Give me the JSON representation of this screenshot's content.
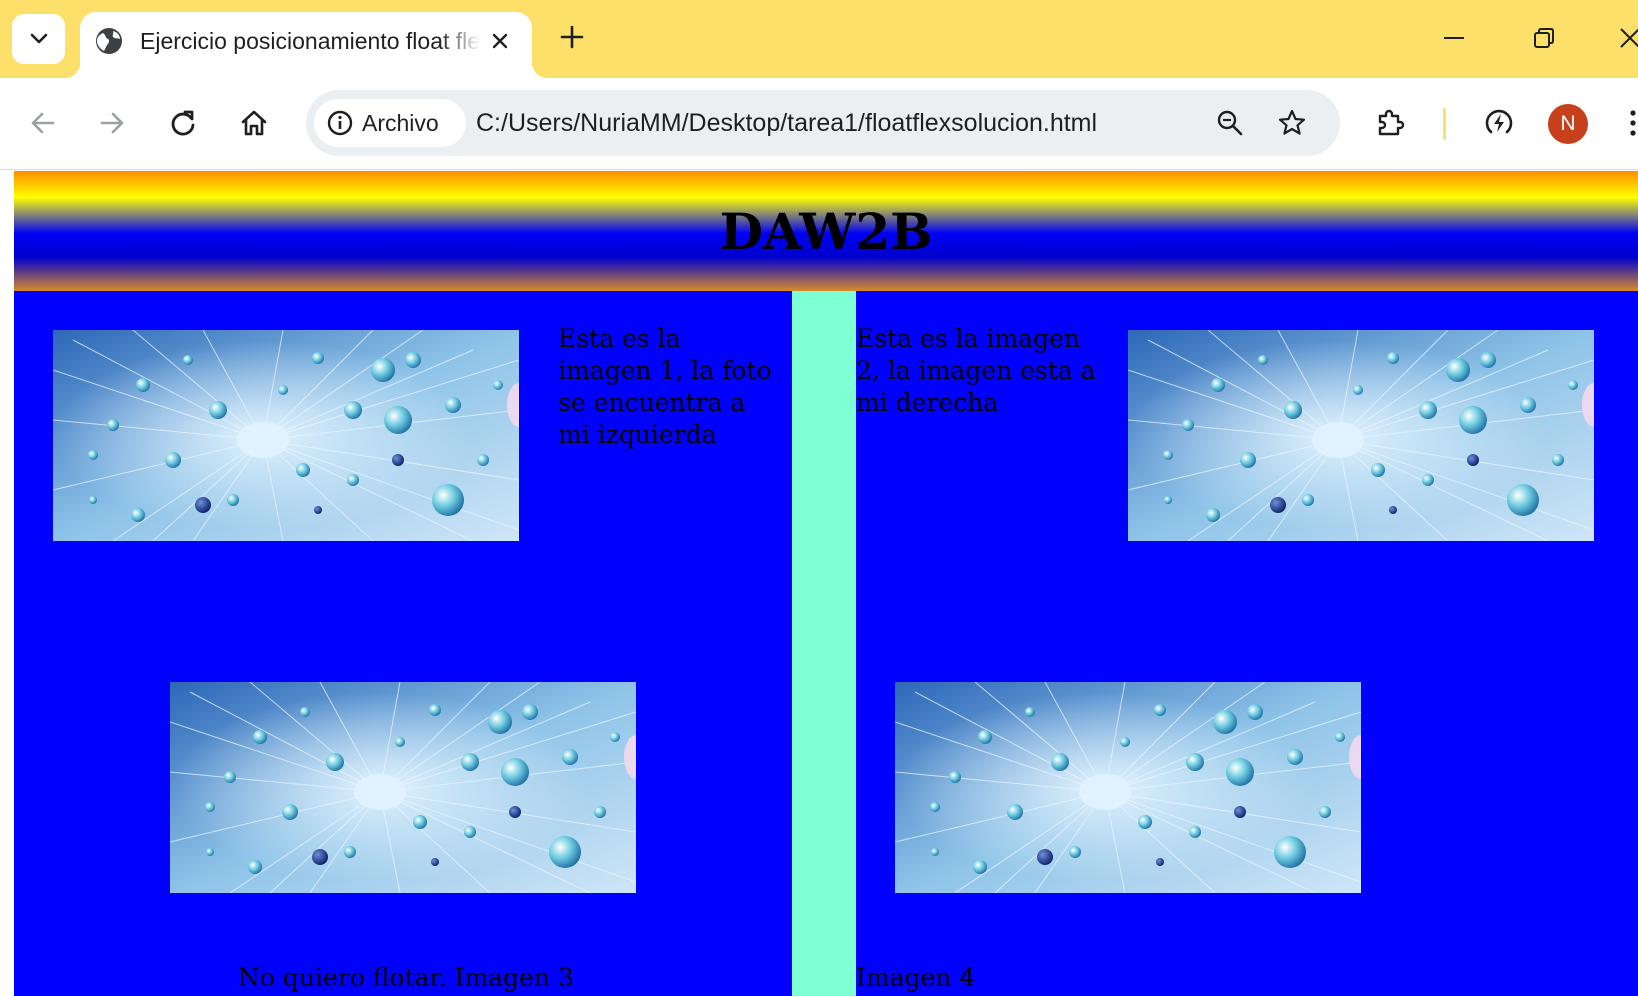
{
  "browser": {
    "tab": {
      "title": "Ejercicio posicionamiento float flex"
    },
    "site_info_label": "Archivo",
    "url": "C:/Users/NuriaMM/Desktop/tarea1/floatflexsolucion.html",
    "profile_initial": "N",
    "colors": {
      "frame": "#fde06a",
      "avatar": "#c5401b"
    }
  },
  "page": {
    "title": "DAW2B",
    "image1_caption": "Esta es la imagen 1, la foto se encuentra a mi izquierda",
    "image2_caption": "Esta es la imagen 2, la imagen esta a mi derecha",
    "image3_caption": "No quiero flotar. Imagen 3",
    "image4_caption": "Imagen 4",
    "colors": {
      "section_bg": "#0000ff",
      "gutter_bg": "#7fffd4"
    }
  }
}
